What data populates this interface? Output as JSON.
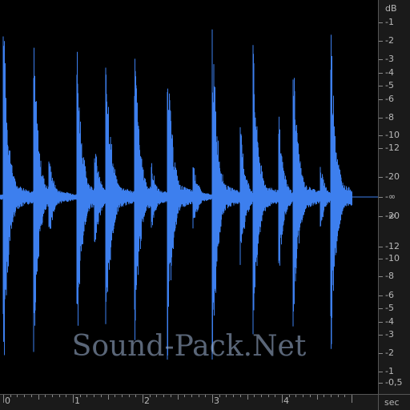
{
  "db_scale": {
    "unit": "dB",
    "top_labels": [
      "-1",
      "-2",
      "-3",
      "-4",
      "-5",
      "-6",
      "-8",
      "-10",
      "-12",
      "-20"
    ],
    "center_label": "-∞",
    "center_sub_label": "-∞",
    "bottom_labels": [
      "-20",
      "-12",
      "-10",
      "-8",
      "-6",
      "-5",
      "-4",
      "-3",
      "-2",
      "-1",
      "-0,5"
    ]
  },
  "time_scale": {
    "unit": "sec",
    "labels": [
      "0",
      "1",
      "2",
      "3",
      "4"
    ]
  },
  "waveform": {
    "color": "#3d7fee",
    "hits": [
      {
        "t": 0.0,
        "amp": 0.98
      },
      {
        "t": 0.43,
        "amp": 0.9
      },
      {
        "t": 0.65,
        "amp": 0.25
      },
      {
        "t": 1.05,
        "amp": 0.93
      },
      {
        "t": 1.3,
        "amp": 0.35
      },
      {
        "t": 1.47,
        "amp": 0.9
      },
      {
        "t": 1.88,
        "amp": 0.92
      },
      {
        "t": 2.12,
        "amp": 0.2
      },
      {
        "t": 2.35,
        "amp": 0.94
      },
      {
        "t": 2.72,
        "amp": 0.2
      },
      {
        "t": 3.0,
        "amp": 0.96
      },
      {
        "t": 3.4,
        "amp": 0.4
      },
      {
        "t": 3.58,
        "amp": 0.9
      },
      {
        "t": 3.95,
        "amp": 0.45
      },
      {
        "t": 4.15,
        "amp": 0.92
      },
      {
        "t": 4.55,
        "amp": 0.18
      },
      {
        "t": 4.7,
        "amp": 0.93
      }
    ],
    "duration": 5.0
  },
  "watermark": "Sound-Pack.Net"
}
